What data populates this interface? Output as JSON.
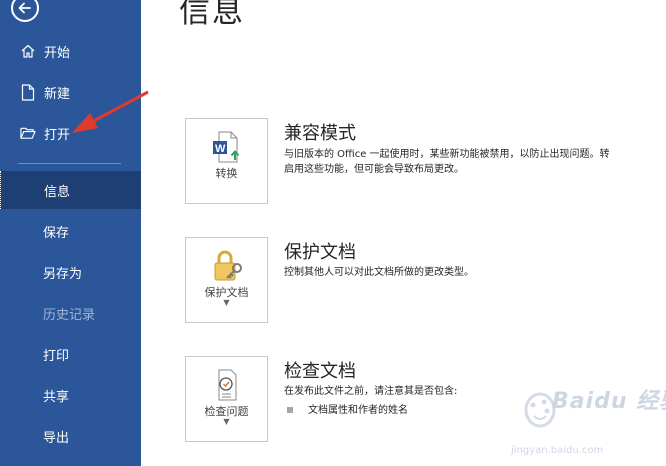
{
  "sidebar": {
    "items": [
      {
        "label": "开始",
        "icon": "home-icon"
      },
      {
        "label": "新建",
        "icon": "new-document-icon"
      },
      {
        "label": "打开",
        "icon": "folder-open-icon"
      },
      {
        "label": "信息",
        "selected": true
      },
      {
        "label": "保存"
      },
      {
        "label": "另存为"
      },
      {
        "label": "历史记录",
        "disabled": true
      },
      {
        "label": "打印"
      },
      {
        "label": "共享"
      },
      {
        "label": "导出"
      }
    ],
    "bg_color": "#2b579a",
    "selected_color": "#1d3f73"
  },
  "main": {
    "title": "信息",
    "sections": [
      {
        "button_label": "转换",
        "button_icon": "word-convert-icon",
        "title": "兼容模式",
        "lines": [
          "与旧版本的 Office 一起使用时，某些新功能被禁用，以防止出现问题。转",
          "启用这些功能，但可能会导致布局更改。"
        ]
      },
      {
        "button_label": "保护文档",
        "button_icon": "lock-key-icon",
        "title": "保护文档",
        "lines": [
          "控制其他人可以对此文档所做的更改类型。"
        ]
      },
      {
        "button_label": "检查问题",
        "button_icon": "inspect-document-icon",
        "title": "检查文档",
        "lines": [
          "在发布此文件之前，请注意其是否包含:"
        ],
        "bullets": [
          "文档属性和作者的姓名"
        ]
      }
    ]
  },
  "watermark": {
    "text": "Baidu 经验",
    "url": "jingyan.baidu.com"
  }
}
